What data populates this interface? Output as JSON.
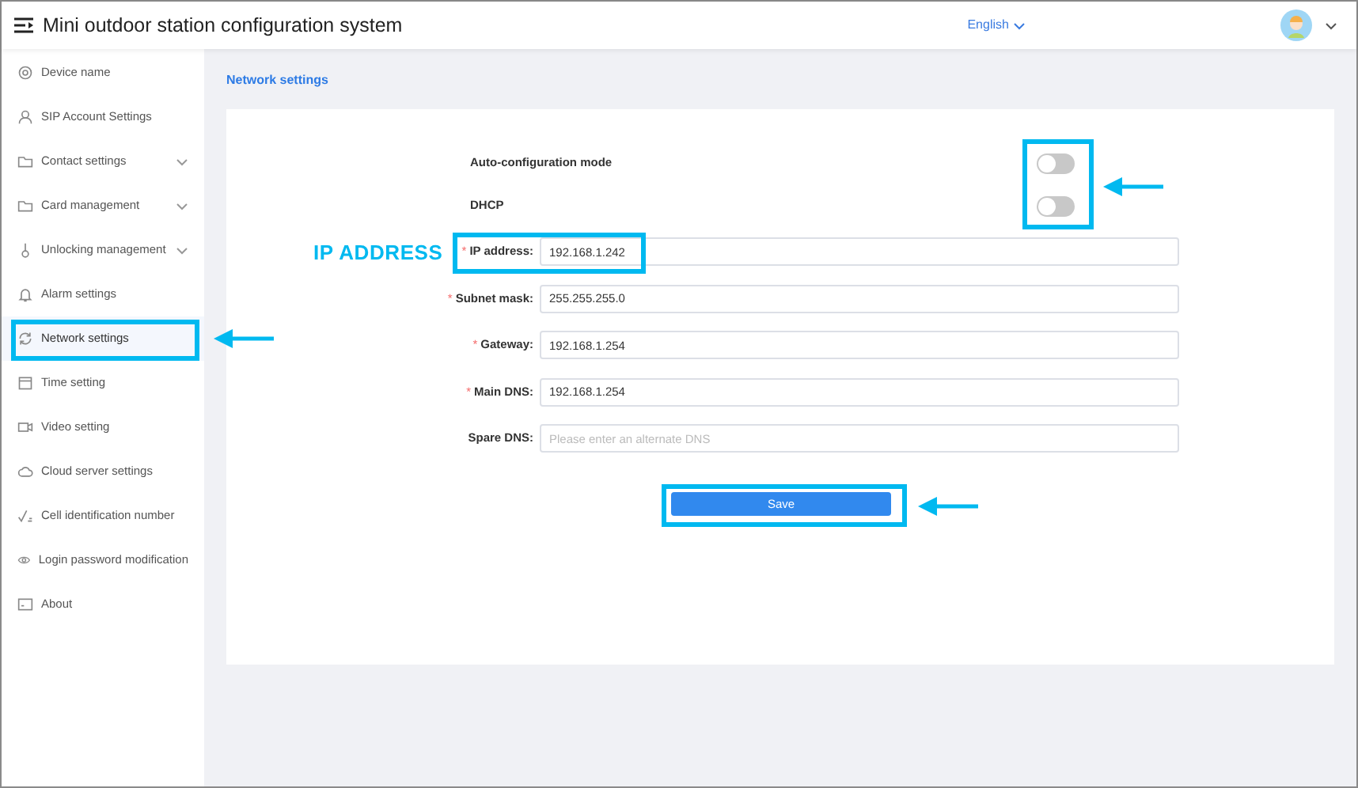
{
  "header": {
    "title": "Mini outdoor station configuration system",
    "language": "English"
  },
  "sidebar": {
    "items": [
      {
        "label": "Device name",
        "selected": false,
        "expandable": false
      },
      {
        "label": "SIP Account Settings",
        "selected": false,
        "expandable": false
      },
      {
        "label": "Contact settings",
        "selected": false,
        "expandable": true
      },
      {
        "label": "Card management",
        "selected": false,
        "expandable": true
      },
      {
        "label": "Unlocking management",
        "selected": false,
        "expandable": true
      },
      {
        "label": "Alarm settings",
        "selected": false,
        "expandable": false
      },
      {
        "label": "Network settings",
        "selected": true,
        "expandable": false
      },
      {
        "label": "Time setting",
        "selected": false,
        "expandable": false
      },
      {
        "label": "Video setting",
        "selected": false,
        "expandable": false
      },
      {
        "label": "Cloud server settings",
        "selected": false,
        "expandable": false
      },
      {
        "label": "Cell identification number",
        "selected": false,
        "expandable": false
      },
      {
        "label": "Login password modification",
        "selected": false,
        "expandable": false
      },
      {
        "label": "About",
        "selected": false,
        "expandable": false
      }
    ]
  },
  "page_title": "Network settings",
  "toggles": [
    {
      "label": "Auto-configuration mode",
      "on": false
    },
    {
      "label": "DHCP",
      "on": false
    }
  ],
  "fields": [
    {
      "label": "IP address:",
      "required_mark": "*",
      "value": "192.168.1.242"
    },
    {
      "label": "Subnet mask:",
      "required_mark": "*",
      "value": "255.255.255.0"
    },
    {
      "label": "Gateway:",
      "required_mark": "*",
      "value": "192.168.1.254"
    },
    {
      "label": "Main DNS:",
      "required_mark": "*",
      "value": "192.168.1.254"
    },
    {
      "label": "Spare DNS:",
      "placeholder": "Please enter an alternate DNS"
    }
  ],
  "save_button": "Save",
  "callout": "IP ADDRESS"
}
